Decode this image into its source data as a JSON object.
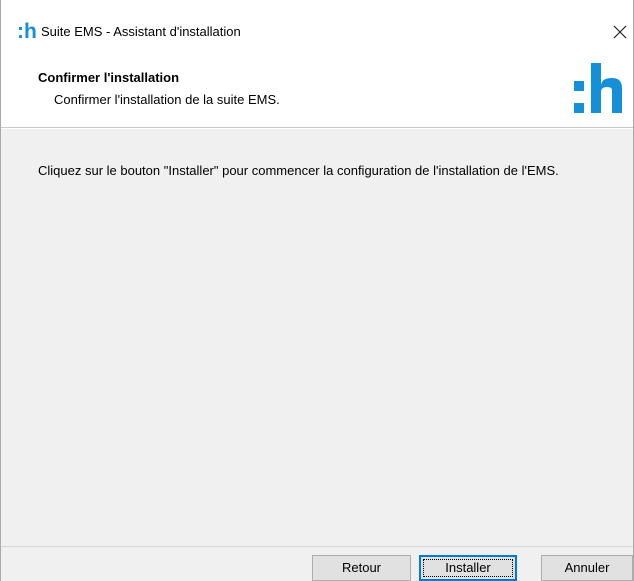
{
  "window": {
    "logo_text": ":h",
    "title": "Suite EMS - Assistant d'installation",
    "close_glyph": "✕"
  },
  "header": {
    "title": "Confirmer l'installation",
    "subtitle": "Confirmer l'installation de la suite EMS.",
    "logo_text": ":h"
  },
  "main": {
    "message": "Cliquez sur le bouton \"Installer\" pour commencer la configuration de l'installation de l'EMS."
  },
  "footer": {
    "back_label": "Retour",
    "install_label": "Installer",
    "cancel_label": "Annuler"
  },
  "colors": {
    "brand": "#1590d8",
    "content_bg": "#f0f0f0",
    "focus_border": "#0078d7"
  }
}
